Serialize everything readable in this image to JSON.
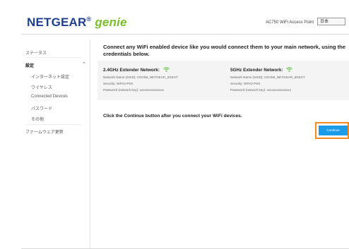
{
  "header": {
    "brand": "NETGEAR",
    "brand_suffix": "genie",
    "model_label": "AC750 WiFi Access Point",
    "language_value": "日本"
  },
  "sidebar": {
    "items": [
      {
        "label": "ステータス"
      },
      {
        "label": "設定"
      },
      {
        "label": "インターネット設定"
      },
      {
        "label": "ワイヤレス"
      },
      {
        "label": "Connected Devices"
      },
      {
        "label": "パスワード"
      },
      {
        "label": "その他"
      },
      {
        "label": "ファームウェア更新"
      }
    ]
  },
  "main": {
    "heading": "Connect any WiFi enabled device like you would connect them to your main network, using the credentials below.",
    "network_24": {
      "title": "2.4GHz Extender Network:",
      "name_line": "Network Name (SSID): C6V3M_NETGEAR_2GEXT",
      "security_line": "Security: WPA2-PSK",
      "password_line": "Password (network key): xxxxxxxxxxxxxxx"
    },
    "network_5": {
      "title": "5GHz Extender Network:",
      "name_line": "Network Name (SSID): C6V3M_NETGEAR_5GEXT",
      "security_line": "Security: WPA2-PSK",
      "password_line": "Password (network key): xxxxxxxxxxxxxxx"
    },
    "instruction": "Click the Continue button after you connect your WiFi devices.",
    "continue_label": "Continue"
  },
  "colors": {
    "brand_blue": "#1f3f8f",
    "genie_green": "#7abf2a",
    "wifi_green": "#5bbf3a",
    "button_blue": "#1b9be8",
    "highlight_orange": "#f28a1e"
  }
}
